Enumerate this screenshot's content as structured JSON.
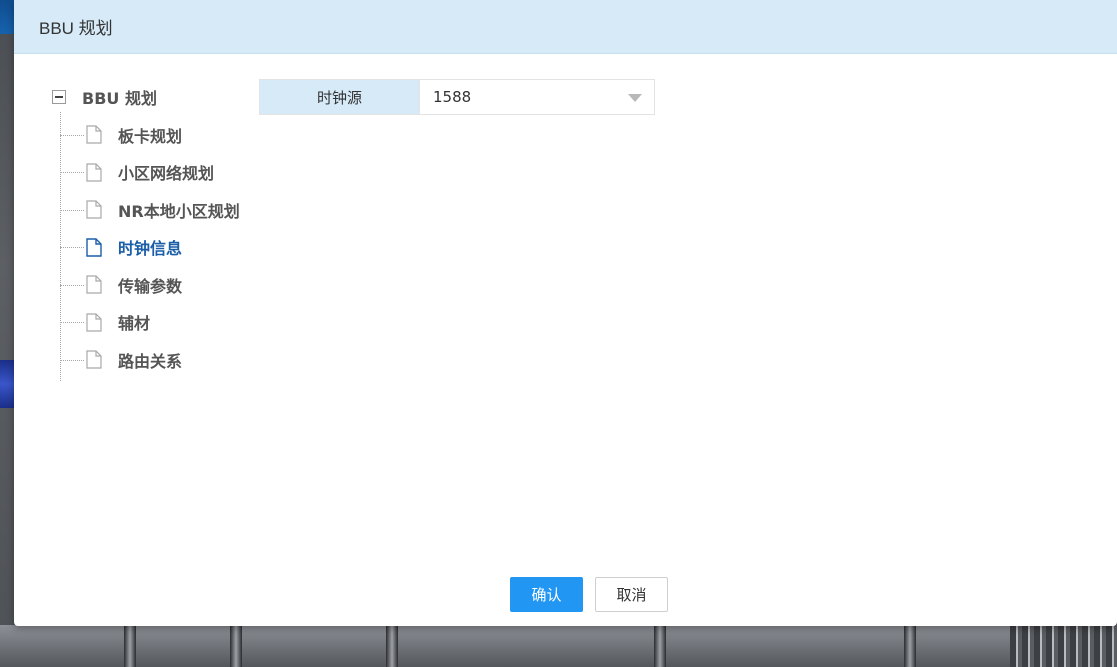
{
  "dialog": {
    "title": "BBU 规划"
  },
  "tree": {
    "root_label": "BBU 规划",
    "items": [
      {
        "label": "板卡规划",
        "active": false
      },
      {
        "label": "小区网络规划",
        "active": false
      },
      {
        "label": "NR本地小区规划",
        "active": false
      },
      {
        "label": "时钟信息",
        "active": true
      },
      {
        "label": "传输参数",
        "active": false
      },
      {
        "label": "辅材",
        "active": false
      },
      {
        "label": "路由关系",
        "active": false
      }
    ]
  },
  "form": {
    "clock_source_label": "时钟源",
    "clock_source_value": "1588"
  },
  "footer": {
    "confirm_label": "确认",
    "cancel_label": "取消"
  },
  "colors": {
    "header_bg": "#d6eaf8",
    "active_text": "#1a5ea8",
    "primary_button": "#2196f3"
  }
}
